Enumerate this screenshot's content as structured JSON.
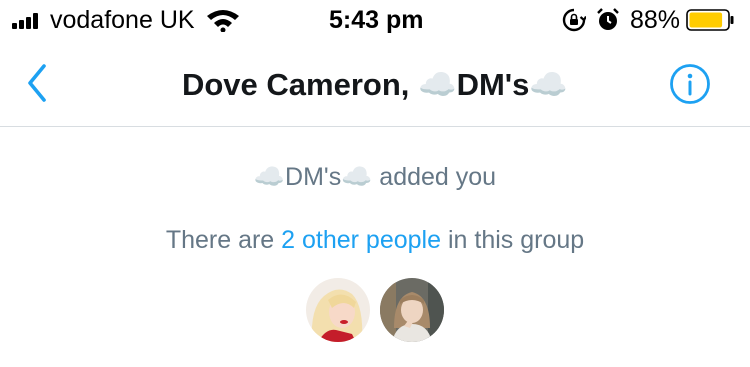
{
  "status_bar": {
    "carrier": "vodafone UK",
    "time": "5:43 pm",
    "battery_percent": "88%",
    "battery_level": 0.88,
    "battery_color": "#ffcc00",
    "icons": [
      "signal-bars-icon",
      "wifi-icon",
      "rotation-lock-icon",
      "alarm-icon",
      "battery-icon"
    ]
  },
  "nav": {
    "title": "Dove Cameron, ☁️DM's☁️",
    "back_icon": "chevron-left-icon",
    "info_icon": "info-icon",
    "accent_color": "#1da1f2"
  },
  "conversation": {
    "added_by": "☁️DM's☁️",
    "added_text": "added you",
    "group_prefix": "There are",
    "group_link": "2 other people",
    "group_suffix": "in this group"
  },
  "members": [
    {
      "name": "member-1-avatar"
    },
    {
      "name": "member-2-avatar"
    }
  ]
}
